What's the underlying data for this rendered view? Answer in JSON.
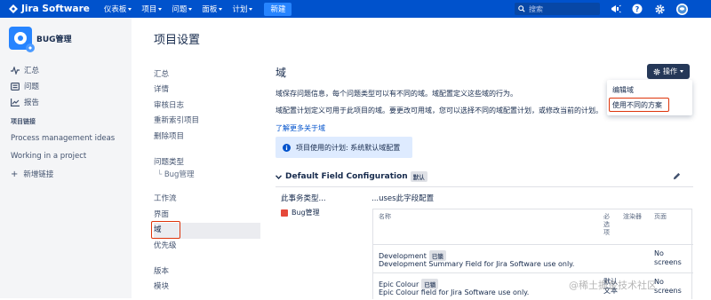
{
  "topnav": {
    "brand": "Jira Software",
    "menu": [
      "仪表板",
      "项目",
      "问题",
      "面板",
      "计划"
    ],
    "create": "新建",
    "search_placeholder": "搜索"
  },
  "sidebar": {
    "project_name": "BUG管理",
    "items": [
      "汇总",
      "问题",
      "报告"
    ],
    "section_title": "项目链接",
    "links": [
      "Process management ideas",
      "Working in a project",
      "新增链接"
    ]
  },
  "page": {
    "title": "项目设置",
    "settings_nav": {
      "group1": [
        "汇总",
        "详情",
        "审核日志",
        "重新索引项目",
        "删除项目"
      ],
      "issue_types": "问题类型",
      "issue_type_child": "Bug管理",
      "group2": [
        "工作流",
        "界面",
        "域",
        "优先级"
      ],
      "group3": [
        "版本",
        "模块"
      ]
    }
  },
  "content": {
    "title": "域",
    "desc1": "域保存问题信息，每个问题类型可以有不同的域。域配置定义这些域的行为。",
    "desc2": "域配置计划定义可用于此项目的域。要更改可用域，您可以选择不同的域配置计划，或修改当前的计划。",
    "learn_more": "了解更多关于域",
    "ops_button": "操作",
    "dropdown": [
      "编辑域",
      "使用不同的方案"
    ],
    "info": "项目使用的计划: 系统默认域配置",
    "config_name": "Default Field Configuration",
    "config_badge": "默认",
    "col_left": "此事务类型...",
    "col_right": "...uses此字段配置",
    "issue_type": "Bug管理",
    "table_headers": {
      "name": "名称",
      "required": "必选项",
      "renderer": "渲染器",
      "screens": "页面"
    },
    "rows": [
      {
        "name": "Development",
        "badge": "已锁",
        "desc": "Development Summary Field for Jira Software use only.",
        "required": "",
        "renderer": "",
        "screens": "No screens"
      },
      {
        "name": "Epic Colour",
        "badge": "已锁",
        "desc": "Epic Colour field for Jira Software use only.",
        "required": "",
        "renderer": "默认文本",
        "screens": "No screens"
      }
    ]
  },
  "watermark": "@稀土掘金技术社区",
  "colors": {
    "nav": "#0052cc",
    "highlight": "#de350b",
    "info_bg": "#deebff",
    "ops_btn": "#253858"
  }
}
